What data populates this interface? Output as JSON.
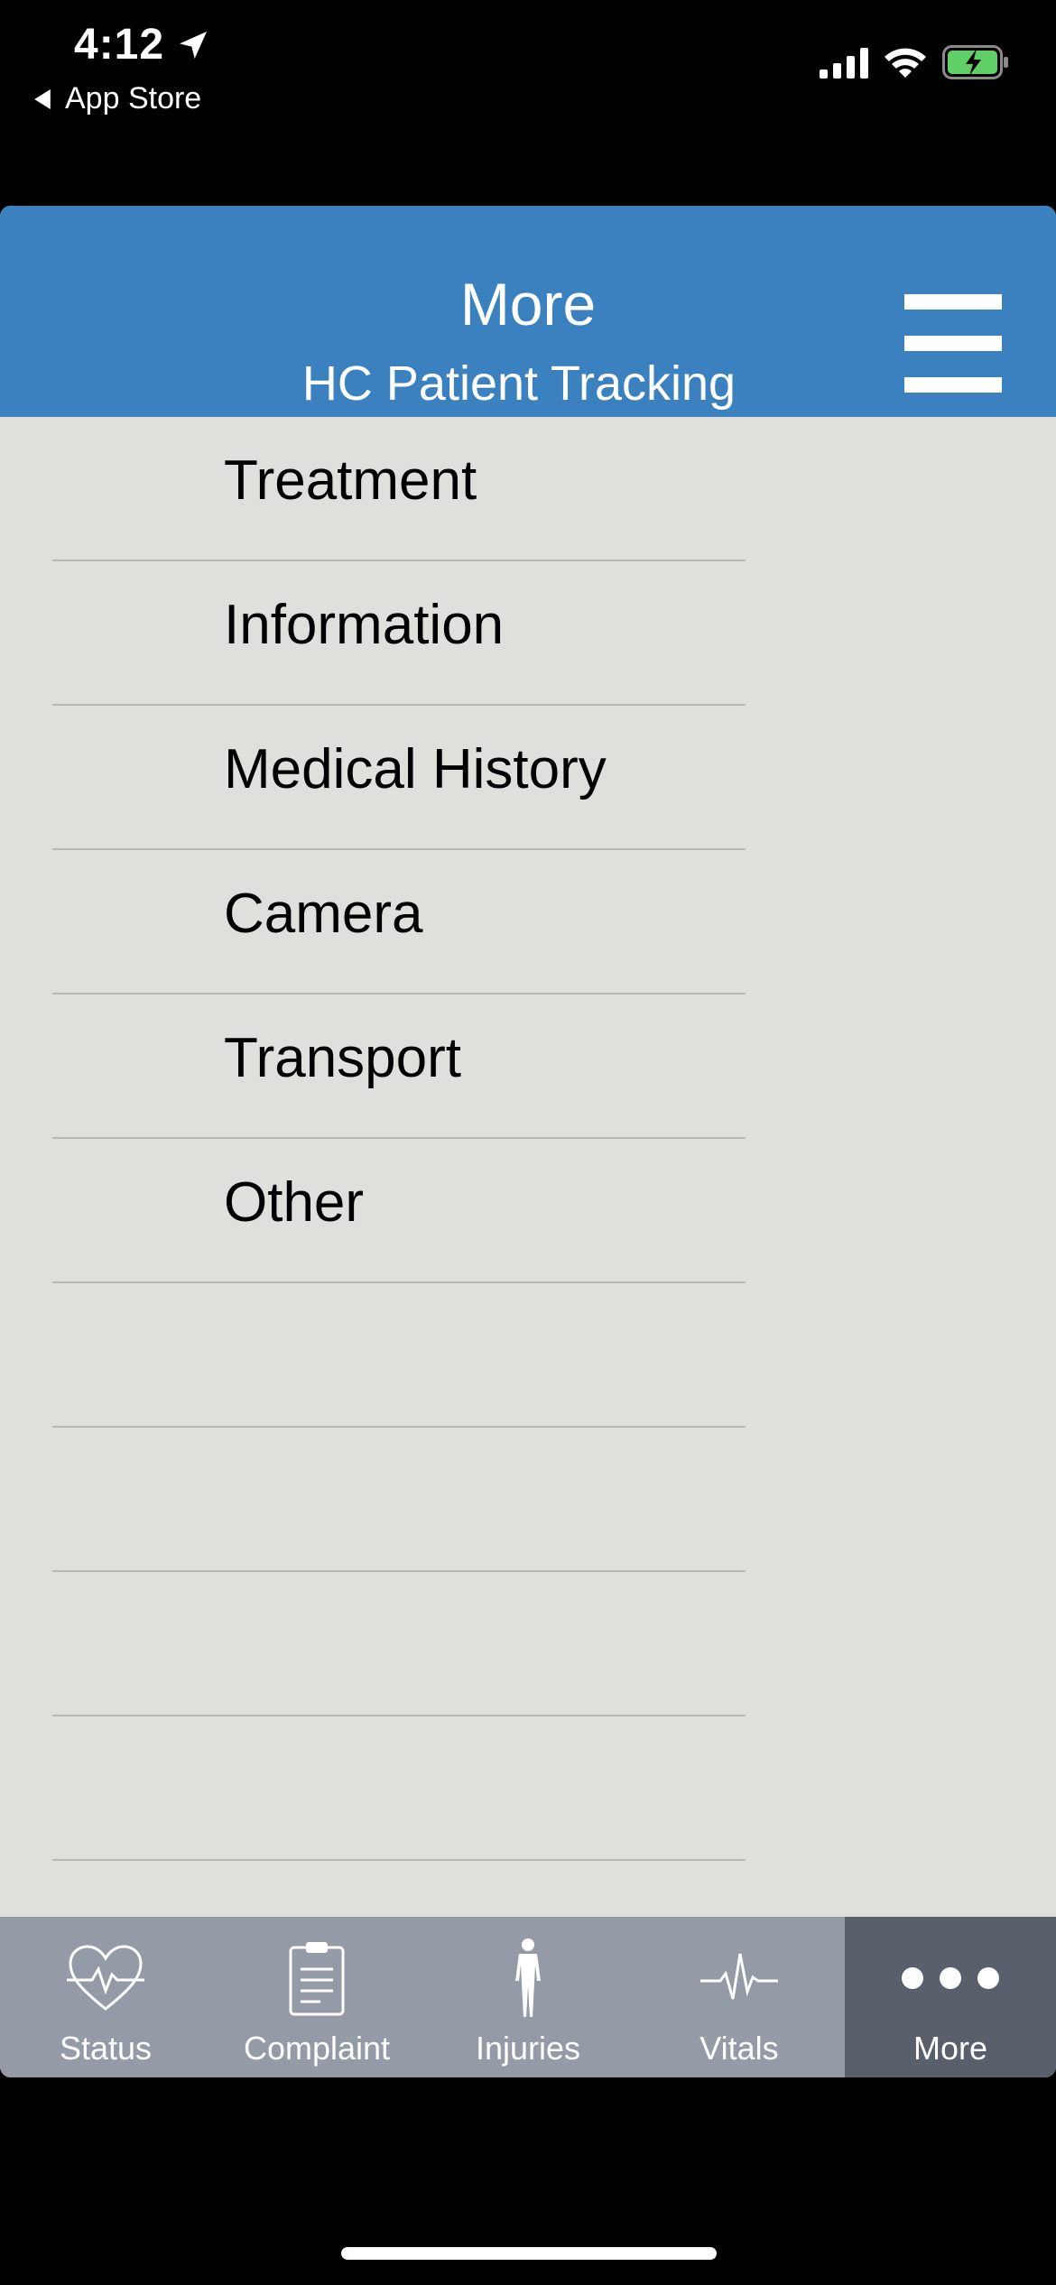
{
  "status_bar": {
    "time": "4:12",
    "back_label": "App Store",
    "icons": [
      "location-arrow-icon",
      "signal-icon",
      "wifi-icon",
      "battery-charging-icon"
    ]
  },
  "header": {
    "title": "More",
    "subtitle": "HC Patient Tracking",
    "menu_icon": "hamburger-menu-icon",
    "background_color": "#3c81bf"
  },
  "menu": {
    "items": [
      {
        "label": "Treatment"
      },
      {
        "label": "Information"
      },
      {
        "label": "Medical History"
      },
      {
        "label": "Camera"
      },
      {
        "label": "Transport"
      },
      {
        "label": "Other"
      },
      {
        "label": ""
      },
      {
        "label": ""
      },
      {
        "label": ""
      },
      {
        "label": ""
      }
    ]
  },
  "tab_bar": {
    "tabs": [
      {
        "label": "Status",
        "icon": "heart-pulse-icon",
        "active": false
      },
      {
        "label": "Complaint",
        "icon": "clipboard-icon",
        "active": false
      },
      {
        "label": "Injuries",
        "icon": "human-body-icon",
        "active": false
      },
      {
        "label": "Vitals",
        "icon": "vitals-waveform-icon",
        "active": false
      },
      {
        "label": "More",
        "icon": "more-dots-icon",
        "active": true
      }
    ],
    "background_color": "#949aa6",
    "active_color": "#5a5f6c"
  }
}
